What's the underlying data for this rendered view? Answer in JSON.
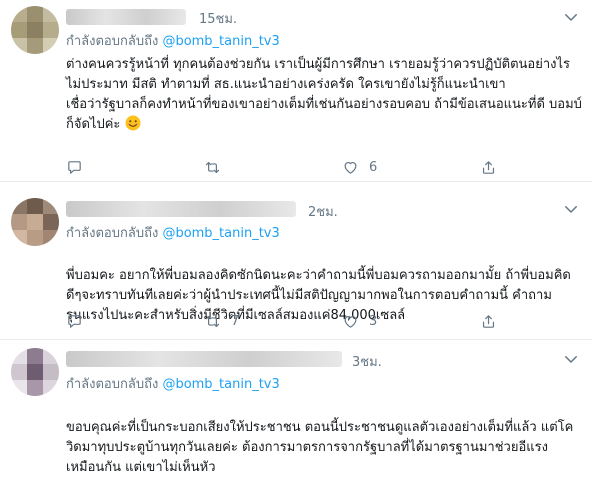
{
  "tweets": [
    {
      "time": "15ชม.",
      "reply_prefix": "กำลังตอบกลับถึง",
      "reply_handle": "@bomb_tanin_tv3",
      "body": "ต่างคนควรรู้หน้าที่ ทุกคนต้องช่วยกัน เราเป็นผู้มีการศึกษา เรายอมรู้ว่าควรปฏิบัติตนอย่างไร ไม่ประมาท มีสติ ทำตามที่ สธ.แนะนำอย่างเคร่งครัด ใครเขายังไม่รู้ก็แนะนำเขา\nเชื่อว่ารัฐบาลก็คงทำหน้าที่ของเขาอย่างเต็มที่เช่นกันอย่างรอบคอบ ถ้ามีข้อเสนอแนะที่ดี บอมบ์ก็จัดไปค่ะ",
      "emoji": "smiling-face-emoji",
      "reply_count": "",
      "retweet_count": "",
      "like_count": "6"
    },
    {
      "time": "2ชม.",
      "reply_prefix": "กำลังตอบกลับถึง",
      "reply_handle": "@bomb_tanin_tv3",
      "body": "พี่บอมคะ อยากให้พี่บอมลองคิดซักนิดนะคะว่าคำถามนี้พี่บอมควรถามออกมามั้ย ถ้าพี่บอมคิดดีๆจะทราบทันทีเลยค่ะว่าผู้นำประเทศนี้ไม่มีสติปัญญามากพอในการตอบคำถามนี้ คำถามรุนแรงไปนะคะสำหรับสิ่งมีชีวิตที่มีเซลล์สมองแค่84,000เซลล์",
      "reply_count": "",
      "retweet_count": "7",
      "like_count": "3"
    },
    {
      "time": "3ชม.",
      "reply_prefix": "กำลังตอบกลับถึง",
      "reply_handle": "@bomb_tanin_tv3",
      "body": "ขอบคุณค่ะที่เป็นกระบอกเสียงให้ประชาชน ตอนนี้ประชาชนดูแลตัวเองอย่างเต็มที่แล้ว แต่โควิดมาทุบประตูบ้านทุกวันเลยค่ะ ต้องการมาตรการจากรัฐบาลที่ได้มาตรฐานมาช่วยอีแรงเหมือนกัน แต่เขาไม่เห็นหัว"
    }
  ],
  "colors": {
    "link": "#1da1f2",
    "muted": "#657786",
    "text": "#14171a",
    "divider": "#e6ecf0"
  },
  "icons": [
    "chevron-down-icon",
    "reply-icon",
    "retweet-icon",
    "like-icon",
    "share-icon"
  ]
}
